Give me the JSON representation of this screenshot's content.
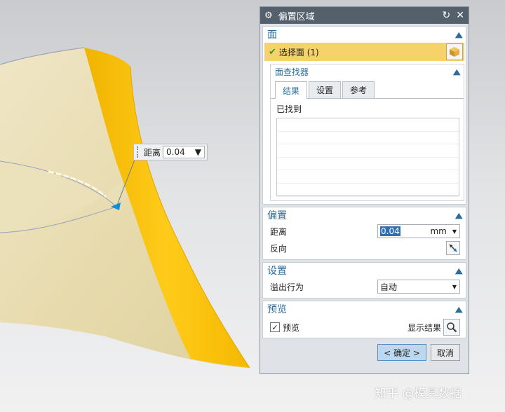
{
  "viewport": {
    "distance_label": "距离",
    "distance_value": "0.04"
  },
  "dialog": {
    "title": "偏置区域",
    "face_section": {
      "header": "面",
      "select_label": "选择面 (1)",
      "finder": {
        "header": "面查找器",
        "tabs": [
          "结果",
          "设置",
          "参考"
        ],
        "found_label": "已找到"
      }
    },
    "offset_section": {
      "header": "偏置",
      "distance_label": "距离",
      "distance_value": "0.04",
      "unit": "mm",
      "reverse_label": "反向"
    },
    "settings_section": {
      "header": "设置",
      "overflow_label": "溢出行为",
      "overflow_value": "自动"
    },
    "preview_section": {
      "header": "预览",
      "preview_label": "预览",
      "preview_checked": true,
      "show_result_label": "显示结果"
    },
    "buttons": {
      "ok": "< 确定 >",
      "cancel": "取消"
    }
  },
  "watermark": "知乎 @模具数据",
  "colors": {
    "title_bar": "#54606c",
    "accent": "#2a6d9c",
    "selected_face": "#f7c31c",
    "selection_row": "#f7d26a"
  }
}
